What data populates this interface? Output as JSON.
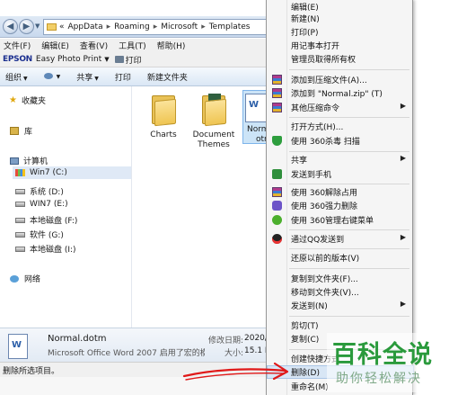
{
  "address_bar": {
    "path": [
      "AppData",
      "Roaming",
      "Microsoft",
      "Templates"
    ],
    "prefix": "«",
    "separator": "▸"
  },
  "menubar": [
    "文件(F)",
    "编辑(E)",
    "查看(V)",
    "工具(T)",
    "帮助(H)"
  ],
  "epson_bar": {
    "logo": "EPSON",
    "app_name": "Easy Photo Print",
    "print_label": "打印"
  },
  "command_bar": {
    "organize": "组织",
    "share": "共享",
    "print": "打印",
    "new_folder": "新建文件夹"
  },
  "nav_pane": {
    "favorites": "收藏夹",
    "libraries": "库",
    "computer": "计算机",
    "drives": [
      "Win7 (C:)",
      "系统 (D:)",
      "WIN7 (E:)",
      "本地磁盘 (F:)",
      "软件 (G:)",
      "本地磁盘 (I:)"
    ],
    "network": "网络"
  },
  "files": [
    {
      "name": "Charts"
    },
    {
      "name": "Document Themes"
    },
    {
      "name": "Normal.dotm",
      "name_visible": "Norm",
      "name_visible_2": "otm"
    }
  ],
  "details_pane": {
    "file_name": "Normal.dotm",
    "file_type": "Microsoft Office Word 2007 启用了宏的模...",
    "modified_label": "修改日期:",
    "modified_value": "2020/3",
    "size_label": "大小:",
    "size_value": "15.1 K"
  },
  "status_bar": {
    "text": "删除所选项目。"
  },
  "context_menu": {
    "items": [
      {
        "label": "编辑(E)"
      },
      {
        "label": "新建(N)"
      },
      {
        "label": "打印(P)"
      },
      {
        "label": "用记事本打开"
      },
      {
        "label": "管理员取得所有权"
      },
      {
        "label": "添加到压缩文件(A)...",
        "icon": "winrar-icon"
      },
      {
        "label": "添加到 \"Normal.zip\" (T)",
        "icon": "winrar-icon"
      },
      {
        "label": "其他压缩命令",
        "icon": "winrar-icon",
        "submenu": true
      },
      {
        "label": "打开方式(H)..."
      },
      {
        "label": "使用 360杀毒 扫描",
        "icon": "360-shield-icon"
      },
      {
        "label": "共享",
        "submenu": true
      },
      {
        "label": "发送到手机",
        "icon": "phone-icon"
      },
      {
        "label": "使用 360解除占用",
        "icon": "winrar-icon"
      },
      {
        "label": "使用 360强力删除",
        "icon": "shredder-icon"
      },
      {
        "label": "使用 360管理右键菜单",
        "icon": "menu-manager-icon"
      },
      {
        "label": "通过QQ发送到",
        "icon": "qq-icon",
        "submenu": true
      },
      {
        "label": "还原以前的版本(V)"
      },
      {
        "label": "复制到文件夹(F)..."
      },
      {
        "label": "移动到文件夹(V)..."
      },
      {
        "label": "发送到(N)",
        "submenu": true
      },
      {
        "label": "剪切(T)"
      },
      {
        "label": "复制(C)"
      },
      {
        "label": "创建快捷方式"
      },
      {
        "label": "删除(D)"
      },
      {
        "label": "重命名(M)"
      }
    ]
  },
  "watermark": {
    "line1": "百科全说",
    "line2": "助你轻松解决"
  },
  "colors": {
    "accent": "#2a9a3c",
    "selection": "#cce4f7",
    "menu_highlight": "#d8e6f5",
    "arrow": "#e01818"
  }
}
